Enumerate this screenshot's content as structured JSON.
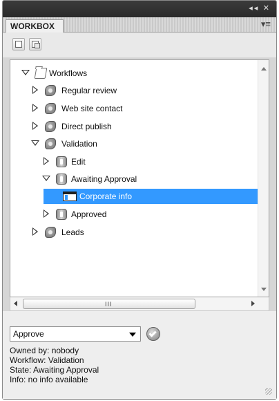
{
  "panel": {
    "tab_title": "WORKBOX",
    "window_controls": "◂◂ ✕",
    "menu_icon": "panel-menu-icon"
  },
  "toolbar": {
    "buttons": [
      {
        "icon": "export-icon"
      },
      {
        "icon": "refresh-icon"
      }
    ]
  },
  "tree": {
    "items": [
      {
        "label": "Workflows",
        "icon": "folder-icon",
        "expanded": true
      },
      {
        "label": "Regular review",
        "icon": "workflow-icon",
        "expanded": false
      },
      {
        "label": "Web site contact",
        "icon": "workflow-icon",
        "expanded": false
      },
      {
        "label": "Direct publish",
        "icon": "workflow-icon",
        "expanded": false
      },
      {
        "label": "Validation",
        "icon": "workflow-icon",
        "expanded": true
      },
      {
        "label": "Edit",
        "icon": "state-icon",
        "expanded": false
      },
      {
        "label": "Awaiting Approval",
        "icon": "state-icon",
        "expanded": true
      },
      {
        "label": "Corporate info",
        "icon": "item-icon",
        "selected": true
      },
      {
        "label": "Approved",
        "icon": "state-icon",
        "expanded": false
      },
      {
        "label": "Leads",
        "icon": "workflow-icon",
        "expanded": false
      }
    ]
  },
  "scrollbar": {
    "grip": "III"
  },
  "action": {
    "selected": "Approve"
  },
  "info": {
    "owned_by": "Owned by: nobody",
    "workflow": "Workflow: Validation",
    "state": "State: Awaiting Approval",
    "info": "Info: no info available"
  }
}
